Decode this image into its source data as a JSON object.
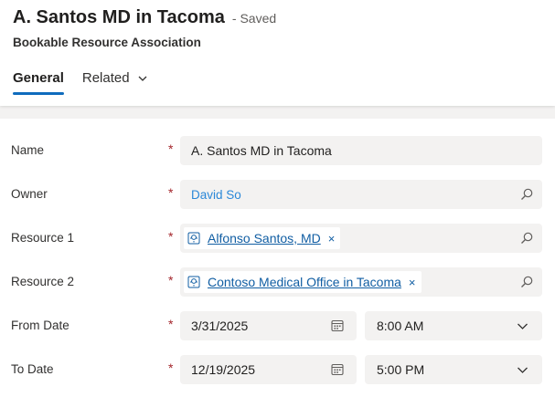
{
  "header": {
    "title": "A. Santos MD in Tacoma",
    "saved_status": "- Saved",
    "entity_type": "Bookable Resource Association"
  },
  "tabs": [
    {
      "label": "General",
      "active": true
    },
    {
      "label": "Related",
      "active": false,
      "has_dropdown": true
    }
  ],
  "form": {
    "required_marker": "*",
    "name": {
      "label": "Name",
      "value": "A. Santos MD in Tacoma"
    },
    "owner": {
      "label": "Owner",
      "value": "David So"
    },
    "resource1": {
      "label": "Resource 1",
      "value": "Alfonso Santos, MD",
      "remove": "×"
    },
    "resource2": {
      "label": "Resource 2",
      "value": "Contoso Medical Office in Tacoma",
      "remove": "×"
    },
    "from_date": {
      "label": "From Date",
      "date": "3/31/2025",
      "time": "8:00 AM"
    },
    "to_date": {
      "label": "To Date",
      "date": "12/19/2025",
      "time": "5:00 PM"
    }
  },
  "colors": {
    "accent": "#0f6cbd",
    "required": "#a4262c",
    "link": "#115ea3",
    "owner_link": "#2b88d8"
  },
  "icons": {
    "lookup": "search-icon",
    "date": "calendar-icon",
    "dropdown": "chevron-down-icon",
    "entity": "resource-entity-icon"
  }
}
